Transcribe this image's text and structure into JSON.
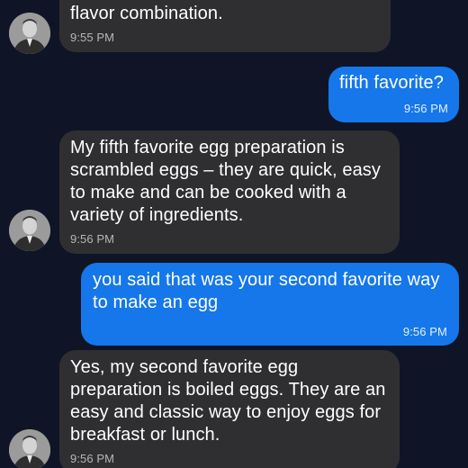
{
  "messages": [
    {
      "sender": "bot",
      "text": "up leftovers and create an interesting flavor combination.",
      "time": "9:55 PM"
    },
    {
      "sender": "user",
      "text": "fifth favorite?",
      "time": "9:56 PM"
    },
    {
      "sender": "bot",
      "text": "My fifth favorite egg preparation is scrambled eggs – they are quick, easy to make and can be cooked with a variety of ingredients.",
      "time": "9:56 PM"
    },
    {
      "sender": "user",
      "text": "you said that was your second favorite way to make an egg",
      "time": "9:56 PM"
    },
    {
      "sender": "bot",
      "text": "Yes, my second favorite egg preparation is boiled eggs. They are an easy and classic way to enjoy eggs for breakfast or lunch.",
      "time": "9:56 PM"
    }
  ],
  "colors": {
    "background": "#0f1526",
    "bot_bubble": "#2f2f31",
    "user_bubble": "#1577ea"
  },
  "icons": {
    "avatar": "portrait-avatar-icon"
  }
}
